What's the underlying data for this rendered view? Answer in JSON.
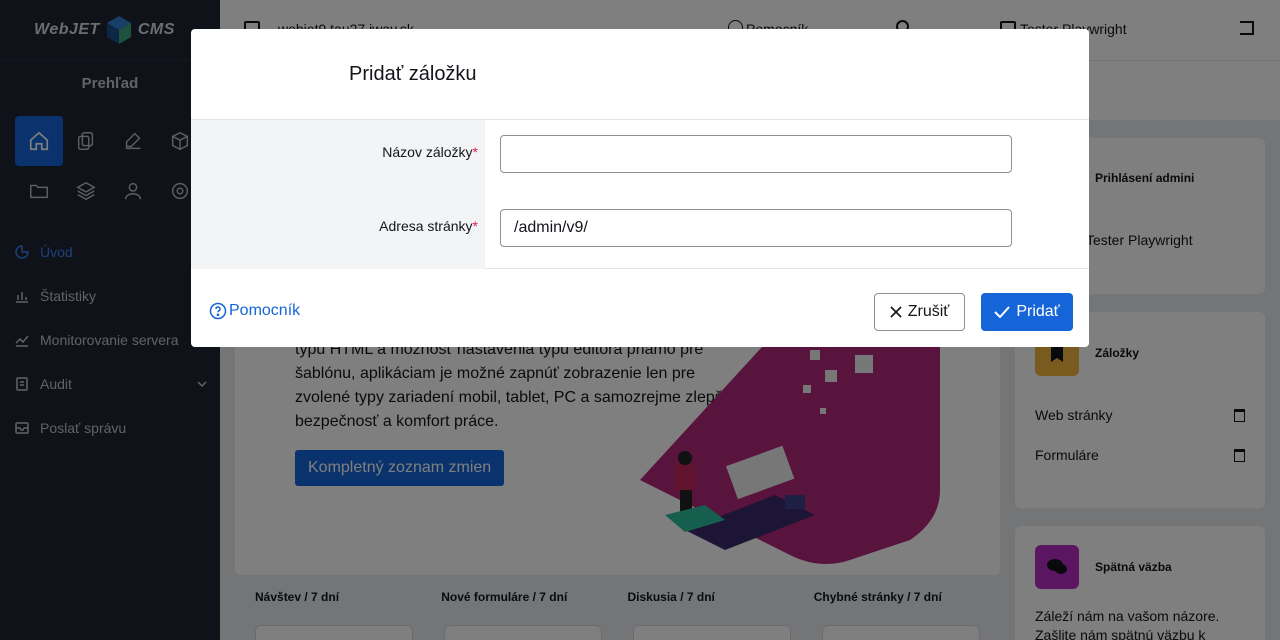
{
  "app": {
    "logo_left": "WebJET",
    "logo_right": "CMS"
  },
  "sidebar": {
    "section_title": "Prehľad",
    "nav": [
      {
        "label": "Úvod",
        "icon": "pie-chart-icon"
      },
      {
        "label": "Štatistiky",
        "icon": "bar-chart-icon"
      },
      {
        "label": "Monitorovanie servera",
        "icon": "line-chart-icon"
      },
      {
        "label": "Audit",
        "icon": "audit-icon"
      },
      {
        "label": "Poslať správu",
        "icon": "message-icon"
      }
    ]
  },
  "topbar": {
    "domain": "webjet9.tau27.iway.sk",
    "help": "Pomocník",
    "user": "Tester Playwright"
  },
  "main": {
    "hero_html_lines": [
      "typu HTML a možnosť nastavenia typu editora priamo pre",
      "šablónu, aplikáciam je možné zapnúť zobrazenie len pre",
      "zvolené typy zariadení mobil, tablet, PC a samozrejme zlepšuje",
      "bezpečnosť a komfort práce."
    ],
    "hero_button": "Kompletný zoznam zmien",
    "stats": [
      "Návštev / 7 dní",
      "Nové formuláre / 7 dní",
      "Diskusia / 7 dní",
      "Chybné stránky / 7 dní"
    ]
  },
  "right": {
    "admins_title": "Prihlásení admini",
    "admin_user": "Tester Playwright",
    "bookmarks_title": "Záložky",
    "bookmarks": [
      "Web stránky",
      "Formuláre"
    ],
    "feedback_title": "Spätná väzba",
    "feedback_text_1": "Záleží nám na vašom názore.",
    "feedback_text_2": "Zašlite nám spätnú väzbu k"
  },
  "modal": {
    "title": "Pridať záložku",
    "fields": [
      {
        "label": "Názov záložky",
        "value": "",
        "required": true
      },
      {
        "label": "Adresa stránky",
        "value": "/admin/v9/",
        "required": true
      }
    ],
    "help": "Pomocník",
    "cancel": "Zrušiť",
    "submit": "Pridať"
  },
  "colors": {
    "primary": "#1565d8",
    "sidebar_bg": "#1f2430",
    "required": "#e11d48"
  }
}
